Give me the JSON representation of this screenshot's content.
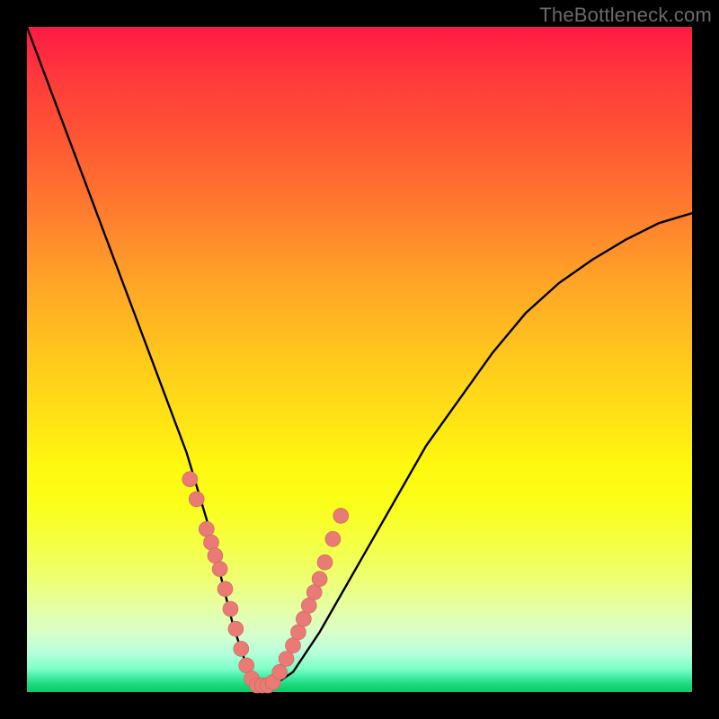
{
  "watermark": "TheBottleneck.com",
  "colors": {
    "frame": "#000000",
    "curve": "#000000",
    "dot_fill": "#e97a76",
    "dot_stroke": "#c96660"
  },
  "chart_data": {
    "type": "line",
    "title": "",
    "xlabel": "",
    "ylabel": "",
    "xlim": [
      0,
      100
    ],
    "ylim": [
      0,
      100
    ],
    "grid": false,
    "legend": false,
    "series": [
      {
        "name": "bottleneck-curve",
        "x": [
          0,
          3,
          6,
          9,
          12,
          15,
          18,
          21,
          24,
          27,
          29,
          31,
          33,
          35,
          37,
          40,
          44,
          48,
          52,
          56,
          60,
          65,
          70,
          75,
          80,
          85,
          90,
          95,
          100
        ],
        "y": [
          100,
          92,
          84,
          76,
          68,
          60,
          52,
          44,
          36,
          26,
          18,
          10,
          4,
          1,
          1,
          3,
          9,
          16,
          23,
          30,
          37,
          44,
          51,
          57,
          61.5,
          65,
          68,
          70.5,
          72
        ]
      }
    ],
    "highlight_points": {
      "name": "dots",
      "x": [
        24.5,
        25.5,
        27.0,
        27.7,
        28.3,
        29.0,
        29.8,
        30.6,
        31.4,
        32.2,
        33.0,
        33.8,
        34.6,
        35.4,
        36.2,
        37.0,
        38.0,
        39.0,
        40.0,
        40.8,
        41.6,
        42.4,
        43.2,
        44.0,
        44.8,
        46.0,
        47.2
      ],
      "y": [
        32.0,
        29.0,
        24.5,
        22.5,
        20.5,
        18.5,
        15.5,
        12.5,
        9.5,
        6.5,
        4.0,
        2.0,
        1.0,
        1.0,
        1.0,
        1.5,
        3.0,
        5.0,
        7.0,
        9.0,
        11.0,
        13.0,
        15.0,
        17.0,
        19.5,
        23.0,
        26.5
      ]
    }
  }
}
